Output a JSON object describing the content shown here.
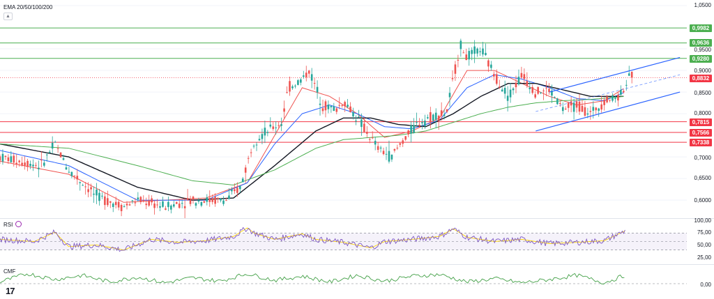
{
  "indicator_title": "EMA 20/50/100/200",
  "rsi_title": "RSI",
  "cmf_title": "CMF",
  "logo_text": "17",
  "colors": {
    "up": "#26a69a",
    "down": "#ef5350",
    "ema20": "#ef5350",
    "ema50": "#2962ff",
    "ema100": "#131722",
    "ema200": "#4caf50",
    "resistance": "#4caf50",
    "support": "#f23645",
    "rsi": "#7e57c2",
    "rsi_ma": "#ffd600",
    "cmf": "#43a047",
    "trend": "#2962ff"
  },
  "price_axis": [
    "1,0500",
    "0,9500",
    "0,9000",
    "0,8500",
    "0,8000",
    "0,7000",
    "0,6500",
    "0,6000"
  ],
  "rsi_axis": [
    "100,00",
    "75,00",
    "50,00",
    "25,00"
  ],
  "cmf_axis": [
    "0,00"
  ],
  "level_tags": [
    {
      "text": "0,9982",
      "kind": "green"
    },
    {
      "text": "0,9636",
      "kind": "green"
    },
    {
      "text": "0,9280",
      "kind": "green"
    },
    {
      "text": "0,8832",
      "kind": "red"
    },
    {
      "text": "0,7815",
      "kind": "red"
    },
    {
      "text": "0,7566",
      "kind": "red"
    },
    {
      "text": "0,7338",
      "kind": "red"
    }
  ],
  "chart_data": {
    "type": "candlestick",
    "title": "EMA 20/50/100/200",
    "y_range": [
      0.56,
      1.05
    ],
    "price_ticks": [
      1.05,
      0.95,
      0.9,
      0.85,
      0.8,
      0.7,
      0.65,
      0.6
    ],
    "levels": {
      "resistance": [
        0.9982,
        0.9636,
        0.928
      ],
      "current": 0.8832,
      "support": [
        0.7815,
        0.7566,
        0.7338
      ]
    },
    "price_path": [
      [
        0,
        0.7
      ],
      [
        0.06,
        0.68
      ],
      [
        0.08,
        0.73
      ],
      [
        0.1,
        0.67
      ],
      [
        0.14,
        0.61
      ],
      [
        0.18,
        0.585
      ],
      [
        0.2,
        0.6
      ],
      [
        0.24,
        0.585
      ],
      [
        0.28,
        0.6
      ],
      [
        0.33,
        0.6
      ],
      [
        0.35,
        0.63
      ],
      [
        0.37,
        0.74
      ],
      [
        0.39,
        0.76
      ],
      [
        0.41,
        0.78
      ],
      [
        0.42,
        0.86
      ],
      [
        0.44,
        0.88
      ],
      [
        0.45,
        0.9
      ],
      [
        0.47,
        0.82
      ],
      [
        0.49,
        0.81
      ],
      [
        0.5,
        0.83
      ],
      [
        0.52,
        0.79
      ],
      [
        0.55,
        0.72
      ],
      [
        0.57,
        0.7
      ],
      [
        0.59,
        0.745
      ],
      [
        0.61,
        0.78
      ],
      [
        0.63,
        0.795
      ],
      [
        0.65,
        0.8
      ],
      [
        0.66,
        0.88
      ],
      [
        0.67,
        0.96
      ],
      [
        0.68,
        0.93
      ],
      [
        0.7,
        0.95
      ],
      [
        0.72,
        0.89
      ],
      [
        0.74,
        0.84
      ],
      [
        0.76,
        0.89
      ],
      [
        0.78,
        0.85
      ],
      [
        0.8,
        0.855
      ],
      [
        0.82,
        0.81
      ],
      [
        0.84,
        0.82
      ],
      [
        0.86,
        0.8
      ],
      [
        0.88,
        0.83
      ],
      [
        0.9,
        0.84
      ],
      [
        0.92,
        0.89
      ]
    ],
    "ema": {
      "ema20": [
        [
          0,
          0.69
        ],
        [
          0.1,
          0.66
        ],
        [
          0.18,
          0.595
        ],
        [
          0.3,
          0.605
        ],
        [
          0.36,
          0.64
        ],
        [
          0.4,
          0.75
        ],
        [
          0.44,
          0.86
        ],
        [
          0.48,
          0.84
        ],
        [
          0.52,
          0.8
        ],
        [
          0.56,
          0.745
        ],
        [
          0.6,
          0.76
        ],
        [
          0.64,
          0.79
        ],
        [
          0.68,
          0.9
        ],
        [
          0.72,
          0.9
        ],
        [
          0.76,
          0.87
        ],
        [
          0.8,
          0.84
        ],
        [
          0.84,
          0.82
        ],
        [
          0.88,
          0.83
        ],
        [
          0.91,
          0.86
        ]
      ],
      "ema50": [
        [
          0,
          0.715
        ],
        [
          0.1,
          0.68
        ],
        [
          0.2,
          0.6
        ],
        [
          0.3,
          0.6
        ],
        [
          0.36,
          0.64
        ],
        [
          0.4,
          0.73
        ],
        [
          0.44,
          0.8
        ],
        [
          0.48,
          0.82
        ],
        [
          0.52,
          0.8
        ],
        [
          0.56,
          0.77
        ],
        [
          0.6,
          0.765
        ],
        [
          0.64,
          0.785
        ],
        [
          0.68,
          0.86
        ],
        [
          0.72,
          0.89
        ],
        [
          0.76,
          0.88
        ],
        [
          0.8,
          0.86
        ],
        [
          0.84,
          0.835
        ],
        [
          0.88,
          0.83
        ],
        [
          0.91,
          0.85
        ]
      ],
      "ema100": [
        [
          0,
          0.73
        ],
        [
          0.1,
          0.7
        ],
        [
          0.2,
          0.63
        ],
        [
          0.28,
          0.6
        ],
        [
          0.34,
          0.605
        ],
        [
          0.4,
          0.68
        ],
        [
          0.46,
          0.76
        ],
        [
          0.5,
          0.79
        ],
        [
          0.54,
          0.79
        ],
        [
          0.58,
          0.775
        ],
        [
          0.62,
          0.77
        ],
        [
          0.66,
          0.8
        ],
        [
          0.7,
          0.84
        ],
        [
          0.74,
          0.87
        ],
        [
          0.78,
          0.87
        ],
        [
          0.82,
          0.855
        ],
        [
          0.86,
          0.84
        ],
        [
          0.91,
          0.84
        ]
      ],
      "ema200": [
        [
          0,
          0.73
        ],
        [
          0.1,
          0.72
        ],
        [
          0.2,
          0.68
        ],
        [
          0.28,
          0.645
        ],
        [
          0.34,
          0.635
        ],
        [
          0.4,
          0.67
        ],
        [
          0.46,
          0.72
        ],
        [
          0.5,
          0.74
        ],
        [
          0.54,
          0.745
        ],
        [
          0.58,
          0.75
        ],
        [
          0.62,
          0.76
        ],
        [
          0.66,
          0.78
        ],
        [
          0.7,
          0.8
        ],
        [
          0.74,
          0.815
        ],
        [
          0.78,
          0.825
        ],
        [
          0.82,
          0.83
        ],
        [
          0.86,
          0.833
        ],
        [
          0.91,
          0.84
        ]
      ]
    },
    "trend_channel": {
      "upper": [
        [
          0.8,
          0.85
        ],
        [
          0.99,
          0.93
        ]
      ],
      "lower": [
        [
          0.78,
          0.76
        ],
        [
          0.99,
          0.85
        ]
      ],
      "mid": [
        [
          0.78,
          0.805
        ],
        [
          0.99,
          0.89
        ]
      ]
    },
    "rsi": {
      "y_range": [
        0,
        100
      ],
      "ticks": [
        100,
        75,
        50,
        25
      ],
      "bands": [
        70,
        50,
        30
      ],
      "path": [
        [
          0,
          55
        ],
        [
          0.05,
          50
        ],
        [
          0.08,
          72
        ],
        [
          0.1,
          38
        ],
        [
          0.14,
          42
        ],
        [
          0.18,
          30
        ],
        [
          0.22,
          55
        ],
        [
          0.26,
          48
        ],
        [
          0.3,
          52
        ],
        [
          0.34,
          62
        ],
        [
          0.36,
          82
        ],
        [
          0.37,
          70
        ],
        [
          0.4,
          55
        ],
        [
          0.44,
          68
        ],
        [
          0.46,
          55
        ],
        [
          0.5,
          48
        ],
        [
          0.54,
          35
        ],
        [
          0.56,
          50
        ],
        [
          0.6,
          55
        ],
        [
          0.64,
          62
        ],
        [
          0.66,
          80
        ],
        [
          0.68,
          60
        ],
        [
          0.72,
          50
        ],
        [
          0.76,
          55
        ],
        [
          0.8,
          45
        ],
        [
          0.84,
          48
        ],
        [
          0.88,
          52
        ],
        [
          0.91,
          75
        ]
      ]
    },
    "cmf": {
      "zero": 0,
      "path": [
        [
          0,
          0.02
        ],
        [
          0.04,
          0.12
        ],
        [
          0.08,
          0.05
        ],
        [
          0.12,
          0.1
        ],
        [
          0.16,
          0.02
        ],
        [
          0.2,
          0.08
        ],
        [
          0.24,
          0.01
        ],
        [
          0.28,
          0.07
        ],
        [
          0.32,
          0.03
        ],
        [
          0.36,
          0.12
        ],
        [
          0.4,
          0.04
        ],
        [
          0.44,
          0.09
        ],
        [
          0.48,
          0.02
        ],
        [
          0.52,
          0.1
        ],
        [
          0.56,
          0.03
        ],
        [
          0.6,
          0.09
        ],
        [
          0.64,
          0.11
        ],
        [
          0.68,
          0.02
        ],
        [
          0.72,
          0.06
        ],
        [
          0.76,
          0.01
        ],
        [
          0.8,
          0.05
        ],
        [
          0.84,
          0.1
        ],
        [
          0.88,
          0.01
        ],
        [
          0.91,
          0.1
        ]
      ]
    }
  }
}
